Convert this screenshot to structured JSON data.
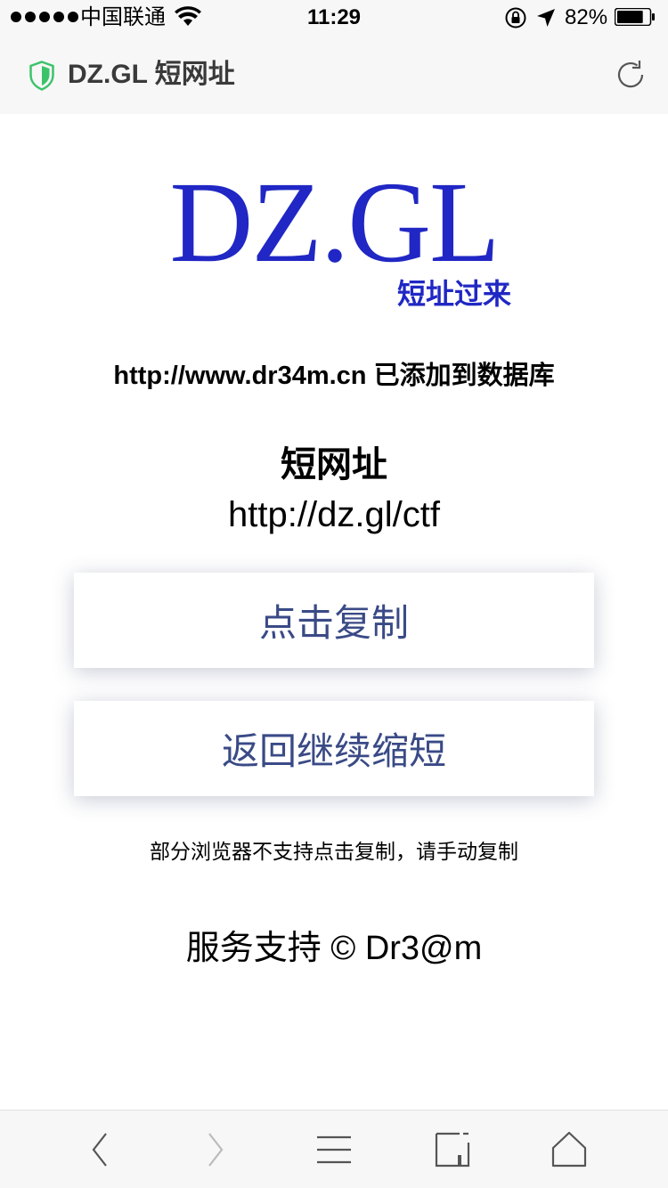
{
  "status_bar": {
    "carrier": "中国联通",
    "time": "11:29",
    "battery": "82%",
    "battery_level": 0.82
  },
  "address_bar": {
    "title": "DZ.GL 短网址"
  },
  "logo": {
    "text": "DZ.GL",
    "subtitle": "短址过来"
  },
  "content": {
    "added_message": "http://www.dr34m.cn 已添加到数据库",
    "short_label": "短网址",
    "short_url": "http://dz.gl/ctf",
    "copy_button": "点击复制",
    "back_button": "返回继续缩短",
    "note": "部分浏览器不支持点击复制，请手动复制",
    "footer": "服务支持 © Dr3@m"
  },
  "colors": {
    "logo": "#2027c4",
    "button_text": "#3a4a86",
    "shield": "#3cc36a"
  },
  "icons": {
    "shield": "shield-icon",
    "reload": "reload-icon",
    "back": "chevron-left-icon",
    "forward": "chevron-right-icon",
    "menu": "menu-icon",
    "tabs": "tabs-icon",
    "home": "home-icon"
  }
}
